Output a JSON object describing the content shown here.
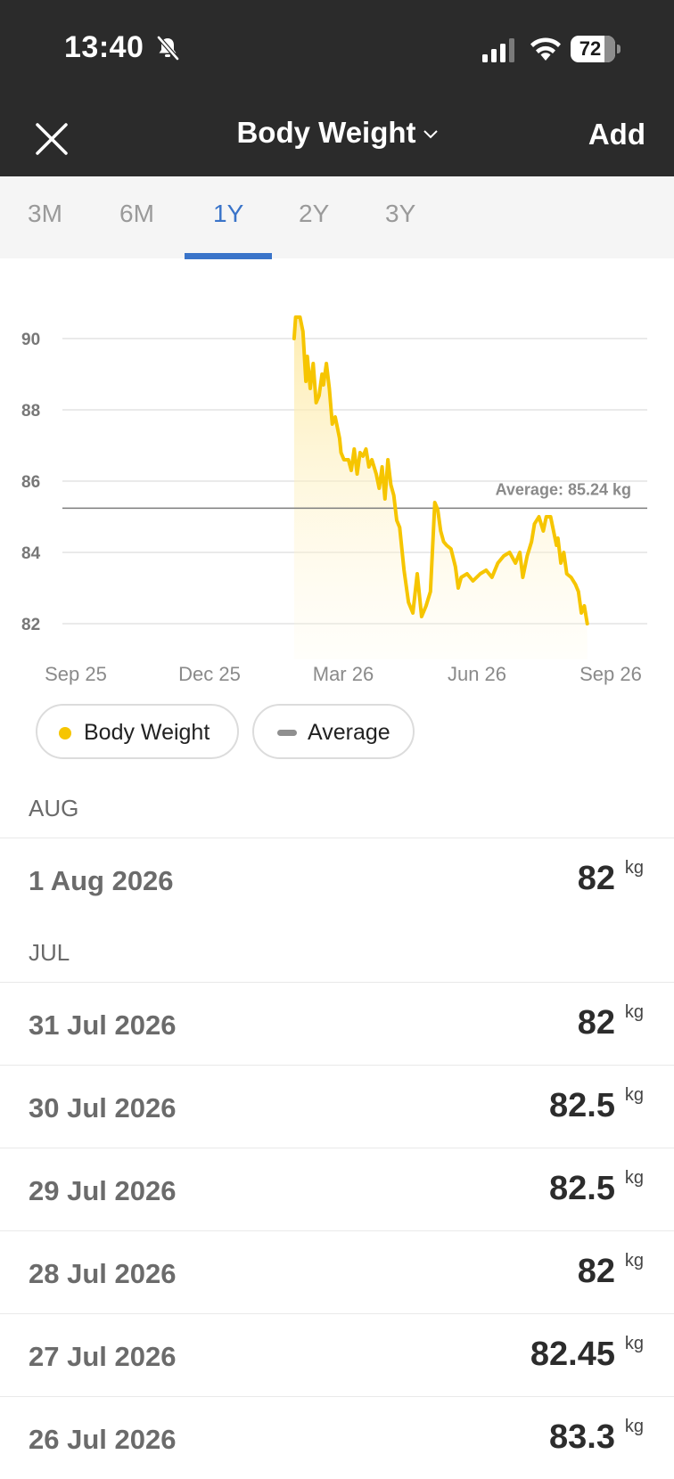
{
  "status_bar": {
    "time": "13:40",
    "battery": "72"
  },
  "header": {
    "title": "Body Weight",
    "add_label": "Add"
  },
  "tabs": [
    {
      "label": "3M"
    },
    {
      "label": "6M"
    },
    {
      "label": "1Y",
      "active": true
    },
    {
      "label": "2Y"
    },
    {
      "label": "3Y"
    }
  ],
  "chart_data": {
    "type": "line",
    "xlabel": "",
    "ylabel": "",
    "x_ticks": [
      "Sep 25",
      "Dec 25",
      "Mar 26",
      "Jun 26",
      "Sep 26"
    ],
    "y_ticks": [
      90,
      88,
      86,
      84,
      82
    ],
    "ylim": [
      81.0,
      91.5
    ],
    "xlim_months": [
      "2025-09",
      "2026-09"
    ],
    "average": {
      "label": "Average: 85.24 kg",
      "value": 85.24
    },
    "series": [
      {
        "name": "Body Weight",
        "color": "#f6c500",
        "points": [
          [
            "2026-01-28",
            90.0
          ],
          [
            "2026-01-29",
            90.6
          ],
          [
            "2026-02-01",
            90.6
          ],
          [
            "2026-02-03",
            90.2
          ],
          [
            "2026-02-05",
            88.8
          ],
          [
            "2026-02-06",
            89.5
          ],
          [
            "2026-02-08",
            88.6
          ],
          [
            "2026-02-10",
            89.3
          ],
          [
            "2026-02-12",
            88.2
          ],
          [
            "2026-02-14",
            88.4
          ],
          [
            "2026-02-16",
            89.0
          ],
          [
            "2026-02-17",
            88.7
          ],
          [
            "2026-02-19",
            89.3
          ],
          [
            "2026-02-21",
            88.6
          ],
          [
            "2026-02-23",
            87.6
          ],
          [
            "2026-02-25",
            87.8
          ],
          [
            "2026-02-28",
            87.2
          ],
          [
            "2026-03-01",
            86.8
          ],
          [
            "2026-03-03",
            86.6
          ],
          [
            "2026-03-06",
            86.6
          ],
          [
            "2026-03-08",
            86.3
          ],
          [
            "2026-03-10",
            86.9
          ],
          [
            "2026-03-12",
            86.2
          ],
          [
            "2026-03-14",
            86.8
          ],
          [
            "2026-03-16",
            86.7
          ],
          [
            "2026-03-18",
            86.9
          ],
          [
            "2026-03-20",
            86.4
          ],
          [
            "2026-03-22",
            86.6
          ],
          [
            "2026-03-25",
            86.2
          ],
          [
            "2026-03-27",
            85.8
          ],
          [
            "2026-03-29",
            86.4
          ],
          [
            "2026-03-31",
            85.5
          ],
          [
            "2026-04-02",
            86.6
          ],
          [
            "2026-04-04",
            85.9
          ],
          [
            "2026-04-06",
            85.6
          ],
          [
            "2026-04-08",
            84.9
          ],
          [
            "2026-04-10",
            84.7
          ],
          [
            "2026-04-13",
            83.5
          ],
          [
            "2026-04-16",
            82.6
          ],
          [
            "2026-04-19",
            82.3
          ],
          [
            "2026-04-22",
            83.4
          ],
          [
            "2026-04-25",
            82.2
          ],
          [
            "2026-04-28",
            82.5
          ],
          [
            "2026-05-01",
            82.9
          ],
          [
            "2026-05-04",
            85.4
          ],
          [
            "2026-05-06",
            85.2
          ],
          [
            "2026-05-08",
            84.6
          ],
          [
            "2026-05-10",
            84.3
          ],
          [
            "2026-05-12",
            84.2
          ],
          [
            "2026-05-15",
            84.1
          ],
          [
            "2026-05-18",
            83.6
          ],
          [
            "2026-05-20",
            83.0
          ],
          [
            "2026-05-22",
            83.3
          ],
          [
            "2026-05-26",
            83.4
          ],
          [
            "2026-05-30",
            83.2
          ],
          [
            "2026-06-04",
            83.4
          ],
          [
            "2026-06-08",
            83.5
          ],
          [
            "2026-06-12",
            83.3
          ],
          [
            "2026-06-16",
            83.7
          ],
          [
            "2026-06-20",
            83.9
          ],
          [
            "2026-06-24",
            84.0
          ],
          [
            "2026-06-28",
            83.7
          ],
          [
            "2026-07-01",
            84.0
          ],
          [
            "2026-07-03",
            83.3
          ],
          [
            "2026-07-06",
            83.9
          ],
          [
            "2026-07-09",
            84.3
          ],
          [
            "2026-07-11",
            84.8
          ],
          [
            "2026-07-14",
            85.0
          ],
          [
            "2026-07-17",
            84.6
          ],
          [
            "2026-07-19",
            85.0
          ],
          [
            "2026-07-22",
            85.0
          ],
          [
            "2026-07-24",
            84.6
          ],
          [
            "2026-07-26",
            84.2
          ],
          [
            "2026-07-27",
            84.4
          ],
          [
            "2026-07-29",
            83.7
          ],
          [
            "2026-07-31",
            84.0
          ],
          [
            "2026-08-02",
            83.4
          ],
          [
            "2026-08-05",
            83.3
          ],
          [
            "2026-08-08",
            83.1
          ],
          [
            "2026-08-10",
            82.9
          ],
          [
            "2026-08-12",
            82.3
          ],
          [
            "2026-08-14",
            82.5
          ],
          [
            "2026-08-16",
            82.0
          ]
        ]
      }
    ]
  },
  "legend": [
    {
      "label": "Body Weight"
    },
    {
      "label": "Average"
    }
  ],
  "entries": {
    "aug": {
      "month": "AUG",
      "rows": [
        {
          "date": "1 Aug 2026",
          "value": "82",
          "unit": "kg"
        }
      ]
    },
    "jul": {
      "month": "JUL",
      "rows": [
        {
          "date": "31 Jul 2026",
          "value": "82",
          "unit": "kg"
        },
        {
          "date": "30 Jul 2026",
          "value": "82.5",
          "unit": "kg"
        },
        {
          "date": "29 Jul 2026",
          "value": "82.5",
          "unit": "kg"
        },
        {
          "date": "28 Jul 2026",
          "value": "82",
          "unit": "kg"
        },
        {
          "date": "27 Jul 2026",
          "value": "82.45",
          "unit": "kg"
        },
        {
          "date": "26 Jul 2026",
          "value": "83.3",
          "unit": "kg"
        }
      ]
    }
  }
}
